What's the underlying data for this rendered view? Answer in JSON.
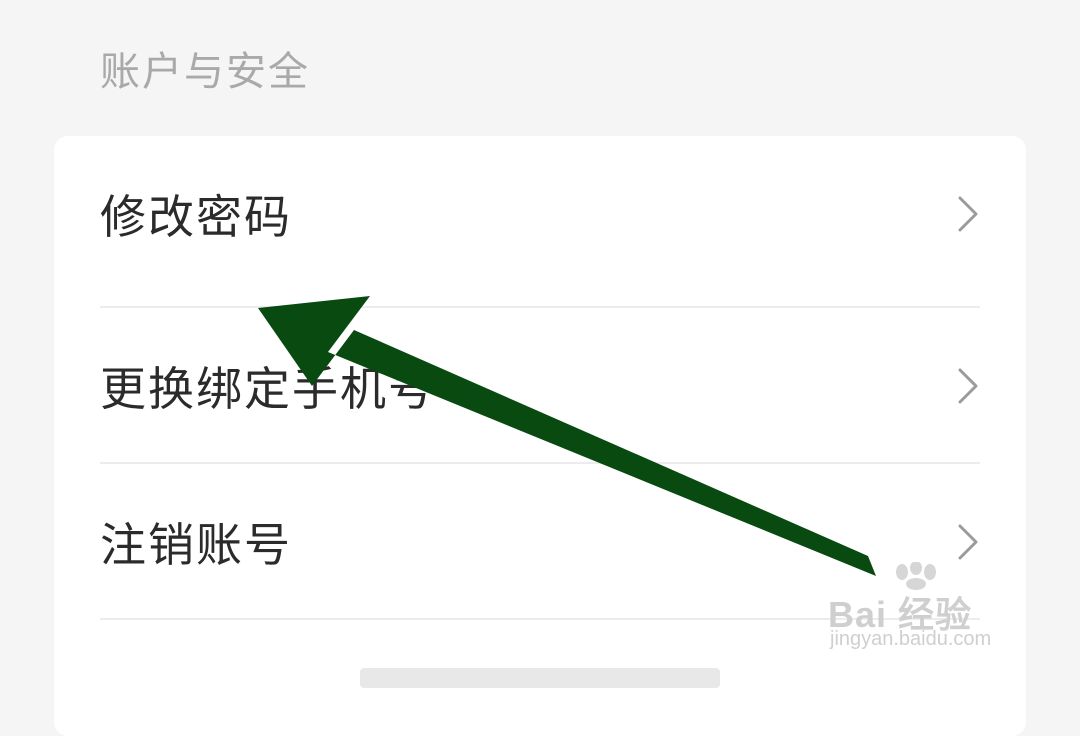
{
  "section": {
    "title": "账户与安全"
  },
  "menu": {
    "items": [
      {
        "label": "修改密码"
      },
      {
        "label": "更换绑定手机号"
      },
      {
        "label": "注销账号"
      }
    ]
  },
  "watermark": {
    "logo": "Bai 经验",
    "url": "jingyan.baidu.com"
  },
  "colors": {
    "background": "#f5f5f5",
    "card": "#ffffff",
    "arrow": "#084a10",
    "title_text": "#a9a9a9",
    "item_text": "#2b2b2b",
    "chevron": "#9b9b9b"
  },
  "icons": {
    "chevron": "chevron-right-icon",
    "arrow": "arrow-annotation-icon"
  }
}
